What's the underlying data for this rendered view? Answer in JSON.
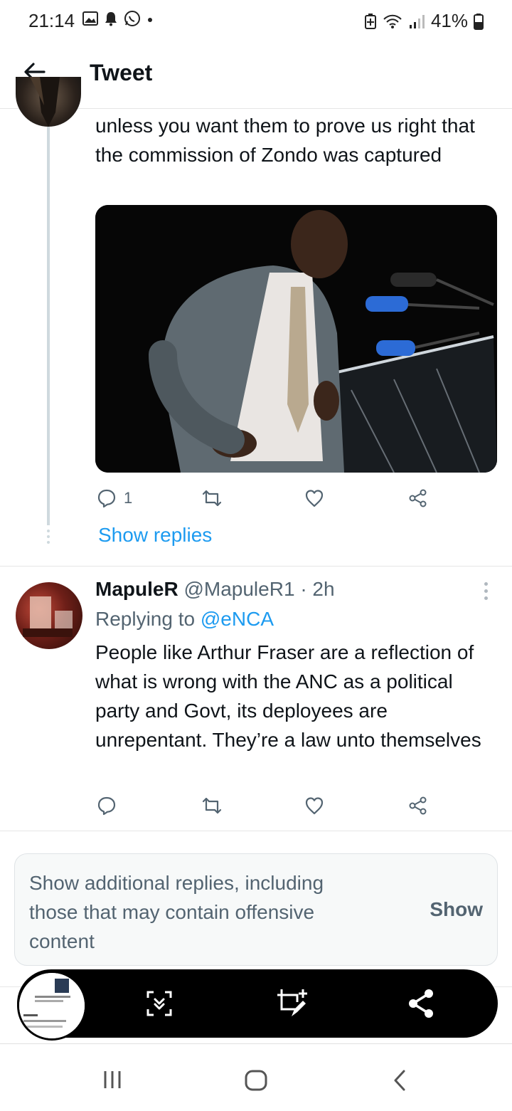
{
  "status_bar": {
    "time": "21:14",
    "battery": "41%",
    "icons": [
      "gallery-icon",
      "notification-bell-icon",
      "whatsapp-icon",
      "dot-icon",
      "battery-saver-icon",
      "wifi-icon",
      "signal-icon",
      "battery-icon"
    ]
  },
  "header": {
    "title": "Tweet"
  },
  "tweet1": {
    "text": "unless you want them to prove us right that the commission of Zondo was captured",
    "reply_count": "1",
    "show_replies": "Show replies"
  },
  "tweet2": {
    "name": "MapuleR",
    "handle": "@MapuleR1",
    "time": "· 2h",
    "replying_prefix": "Replying to",
    "replying_to": "@eNCA",
    "text": "People like Arthur Fraser are a reflection of what is wrong with the ANC as a political party and Govt, its deployees are unrepentant. They’re a law unto themselves"
  },
  "more_replies": {
    "message": "Show additional replies, including those that may contain offensive content",
    "button": "Show"
  },
  "colors": {
    "accent": "#1d9bf0",
    "text_primary": "#0f1419",
    "text_secondary": "#536471",
    "toolbar_bg": "#000000"
  }
}
